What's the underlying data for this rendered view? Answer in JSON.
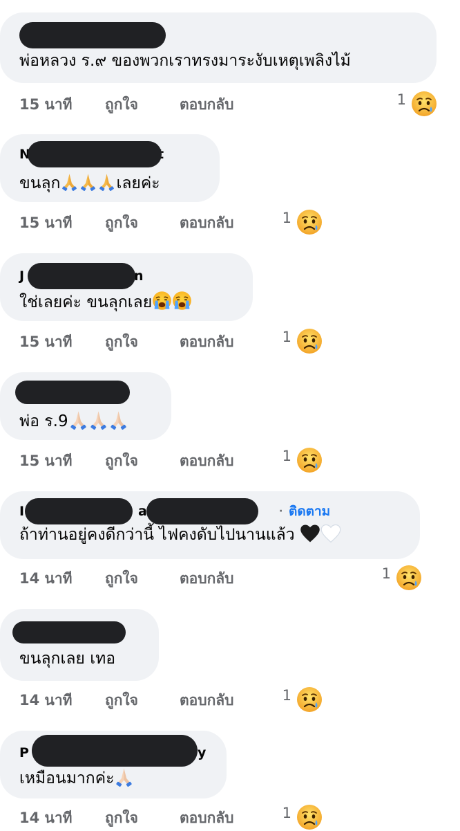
{
  "comments": [
    {
      "text": "พ่อหลวง ร.๙ ของพวกเราทรงมาระงับเหตุเพลิงไม้",
      "time": "15 นาที",
      "like": "ถูกใจ",
      "reply": "ตอบกลับ",
      "reactions": "1",
      "reaction_icon": "sad-tear-emoji"
    },
    {
      "author_first": "N",
      "author_last": "t",
      "text": "ขนลุก",
      "text_after": "เลยค่ะ",
      "time": "15 นาที",
      "like": "ถูกใจ",
      "reply": "ตอบกลับ",
      "reactions": "1"
    },
    {
      "author_first": "J",
      "author_last": "n",
      "text": "ใช่เลยค่ะ ขนลุกเลย",
      "time": "15 นาที",
      "like": "ถูกใจ",
      "reply": "ตอบกลับ",
      "reactions": "1"
    },
    {
      "text": "พ่อ ร.9",
      "time": "15 นาที",
      "like": "ถูกใจ",
      "reply": "ตอบกลับ",
      "reactions": "1"
    },
    {
      "author_first": "I",
      "author_mid": "a V",
      "follow": "ติดตาม",
      "text": "ถ้าท่านอยู่คงดีกว่านี้ ไฟคงดับไปนานแล้ว",
      "time": "14 นาที",
      "like": "ถูกใจ",
      "reply": "ตอบกลับ",
      "reactions": "1"
    },
    {
      "text": "ขนลุกเลย เทอ",
      "time": "14 นาที",
      "like": "ถูกใจ",
      "reply": "ตอบกลับ",
      "reactions": "1"
    },
    {
      "author_first": "P",
      "author_last": "y",
      "text": "เหมือนมากค่ะ",
      "time": "14 นาที",
      "like": "ถูกใจ",
      "reply": "ตอบกลับ",
      "reactions": "1"
    }
  ],
  "icons": {
    "reaction": "sad-tear-emoji",
    "pray": "folded-hands-emoji",
    "cry": "loudly-crying-emoji",
    "black_heart": "black-heart-emoji",
    "white_heart": "white-heart-emoji"
  },
  "colors": {
    "bubble": "#f0f2f5",
    "meta": "#65676b",
    "follow": "#1877f2",
    "redaction": "#202124"
  }
}
